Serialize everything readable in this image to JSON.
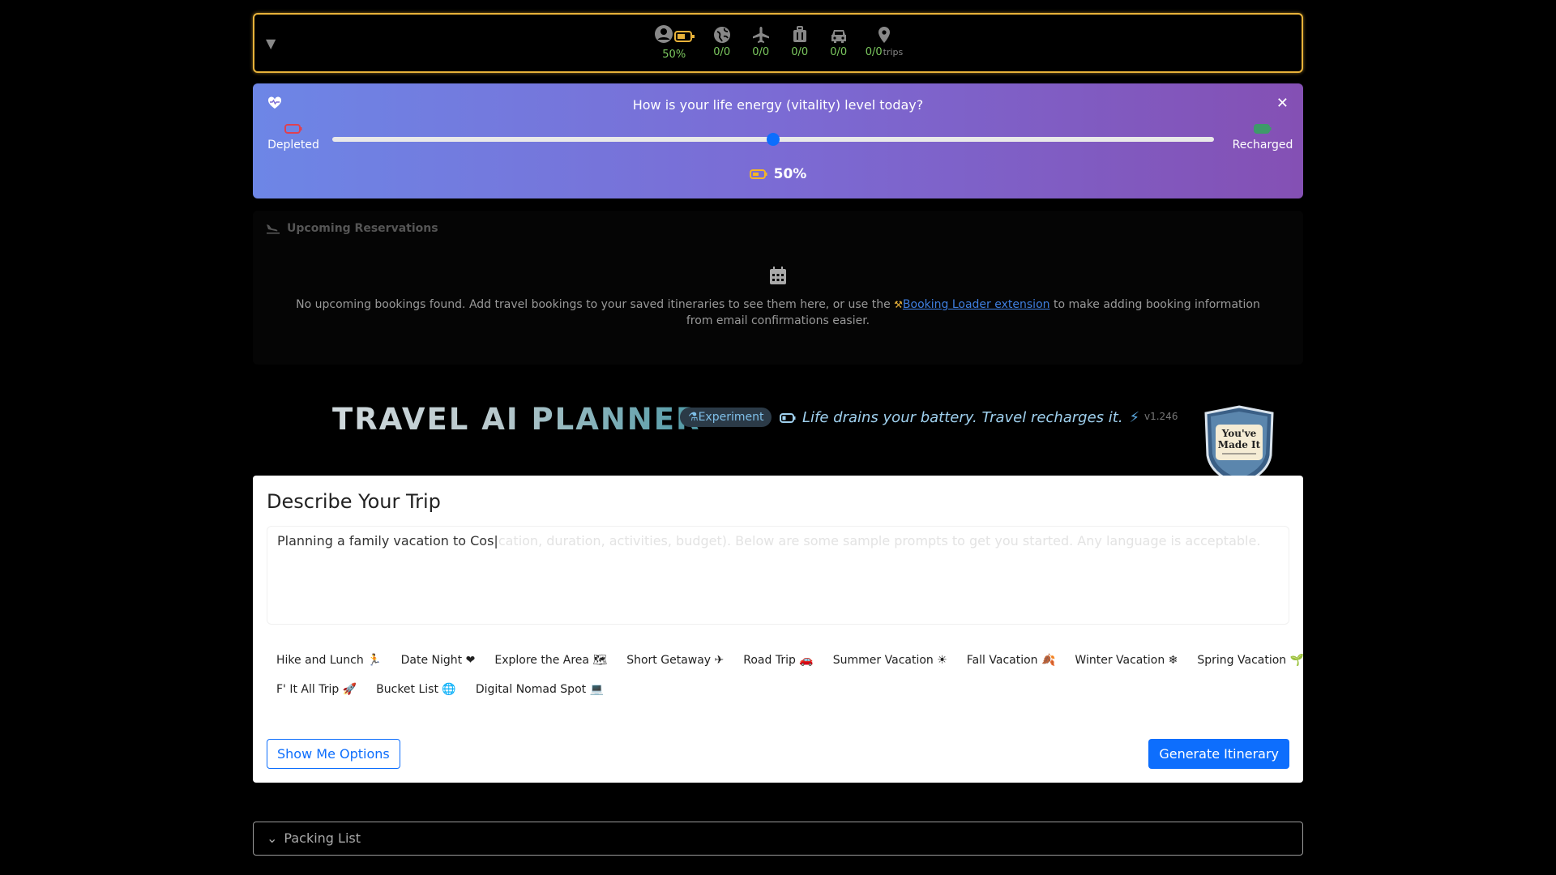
{
  "topbar": {
    "toggle_glyph": "▼",
    "energy_percent": "50%",
    "stats": [
      {
        "icon": "globe-icon",
        "value": "0/0"
      },
      {
        "icon": "airplane-icon",
        "value": "0/0"
      },
      {
        "icon": "luggage-icon",
        "value": "0/0"
      },
      {
        "icon": "car-icon",
        "value": "0/0"
      },
      {
        "icon": "map-pin-icon",
        "value": "0/0",
        "suffix": "trips"
      }
    ]
  },
  "vitality": {
    "question": "How is your life energy (vitality) level today?",
    "close_glyph": "✕",
    "low_label": "Depleted",
    "high_label": "Recharged",
    "level_percent": 50,
    "level_text": "50%"
  },
  "reservations": {
    "heading": "Upcoming Reservations",
    "message_before": "No upcoming bookings found. Add travel bookings to your saved itineraries to see them here, or use the",
    "link_text": "Booking Loader extension",
    "message_after": "to make adding booking information from email confirmations easier."
  },
  "header": {
    "title": "TRAVEL AI PLANNER",
    "badge": "Experiment",
    "tagline": "Life drains your battery. Travel recharges it.",
    "version": "v1.246",
    "seal_text": "You've Made It"
  },
  "describe": {
    "heading": "Describe Your Trip",
    "typed_value": "Planning a family vacation to Cos|",
    "placeholder_tail": "cation, duration, activities, budget). Below are some sample prompts to get you started. Any language is acceptable.",
    "chips_row1": [
      "Hike and Lunch 🏃",
      "Date Night ❤",
      "Explore the Area 🗺",
      "Short Getaway ✈",
      "Road Trip 🚗",
      "Summer Vacation ☀",
      "Fall Vacation 🍂",
      "Winter Vacation ❄",
      "Spring Vacation 🌱"
    ],
    "chips_row2": [
      "F' It All Trip 🚀",
      "Bucket List 🌐",
      "Digital Nomad Spot 💻"
    ],
    "show_options": "Show Me Options",
    "generate": "Generate Itinerary"
  },
  "packing": {
    "label": "Packing List"
  },
  "colors": {
    "accent_gold": "#e8b23a",
    "stat_green": "#7cc95f",
    "primary_blue": "#0d6efd"
  }
}
